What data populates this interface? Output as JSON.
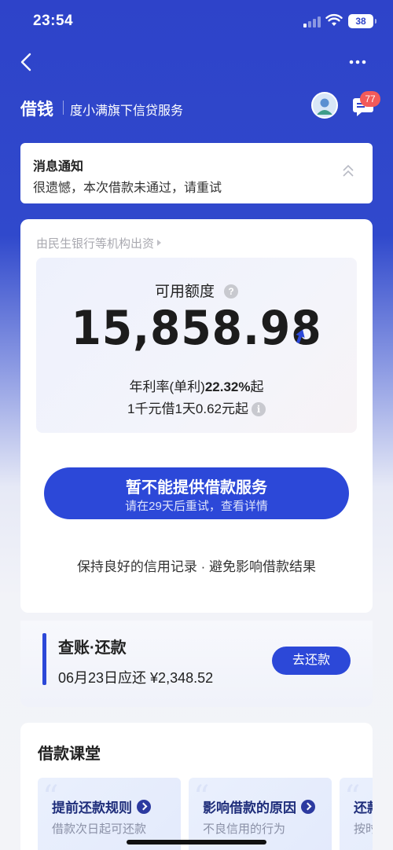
{
  "status_bar": {
    "time": "23:54",
    "battery": "38"
  },
  "header": {
    "title": "借钱",
    "subtitle": "度小满旗下信贷服务",
    "message_count": "77"
  },
  "notice": {
    "title": "消息通知",
    "text": "很遗憾，本次借款未通过，请重试"
  },
  "credit": {
    "lender": "由民生银行等机构出资",
    "label": "可用额度",
    "amount": "15,858.98",
    "rate_prefix": "年利率(单利)",
    "rate_value": "22.32%",
    "rate_suffix": "起",
    "cost": "1千元借1天0.62元起"
  },
  "loan_button": {
    "title": "暂不能提供借款服务",
    "subtitle": "请在29天后重试，查看详情"
  },
  "tip": "保持良好的信用记录 · 避免影响借款结果",
  "repay": {
    "title": "查账·还款",
    "due": "06月23日应还 ¥2,348.52",
    "button": "去还款"
  },
  "classroom": {
    "title": "借款课堂",
    "lessons": [
      {
        "title": "提前还款规则",
        "subtitle": "借款次日起可还款"
      },
      {
        "title": "影响借款的原因",
        "subtitle": "不良信用的行为"
      },
      {
        "title": "还款",
        "subtitle": "按时"
      }
    ]
  },
  "icons": {
    "back": "back-arrow-icon",
    "more": "more-icon",
    "message": "message-icon",
    "help": "help-icon",
    "info": "info-icon",
    "trend": "trend-up-icon"
  },
  "colors": {
    "brand": "#2c48d8",
    "badge": "#f25a5a"
  }
}
